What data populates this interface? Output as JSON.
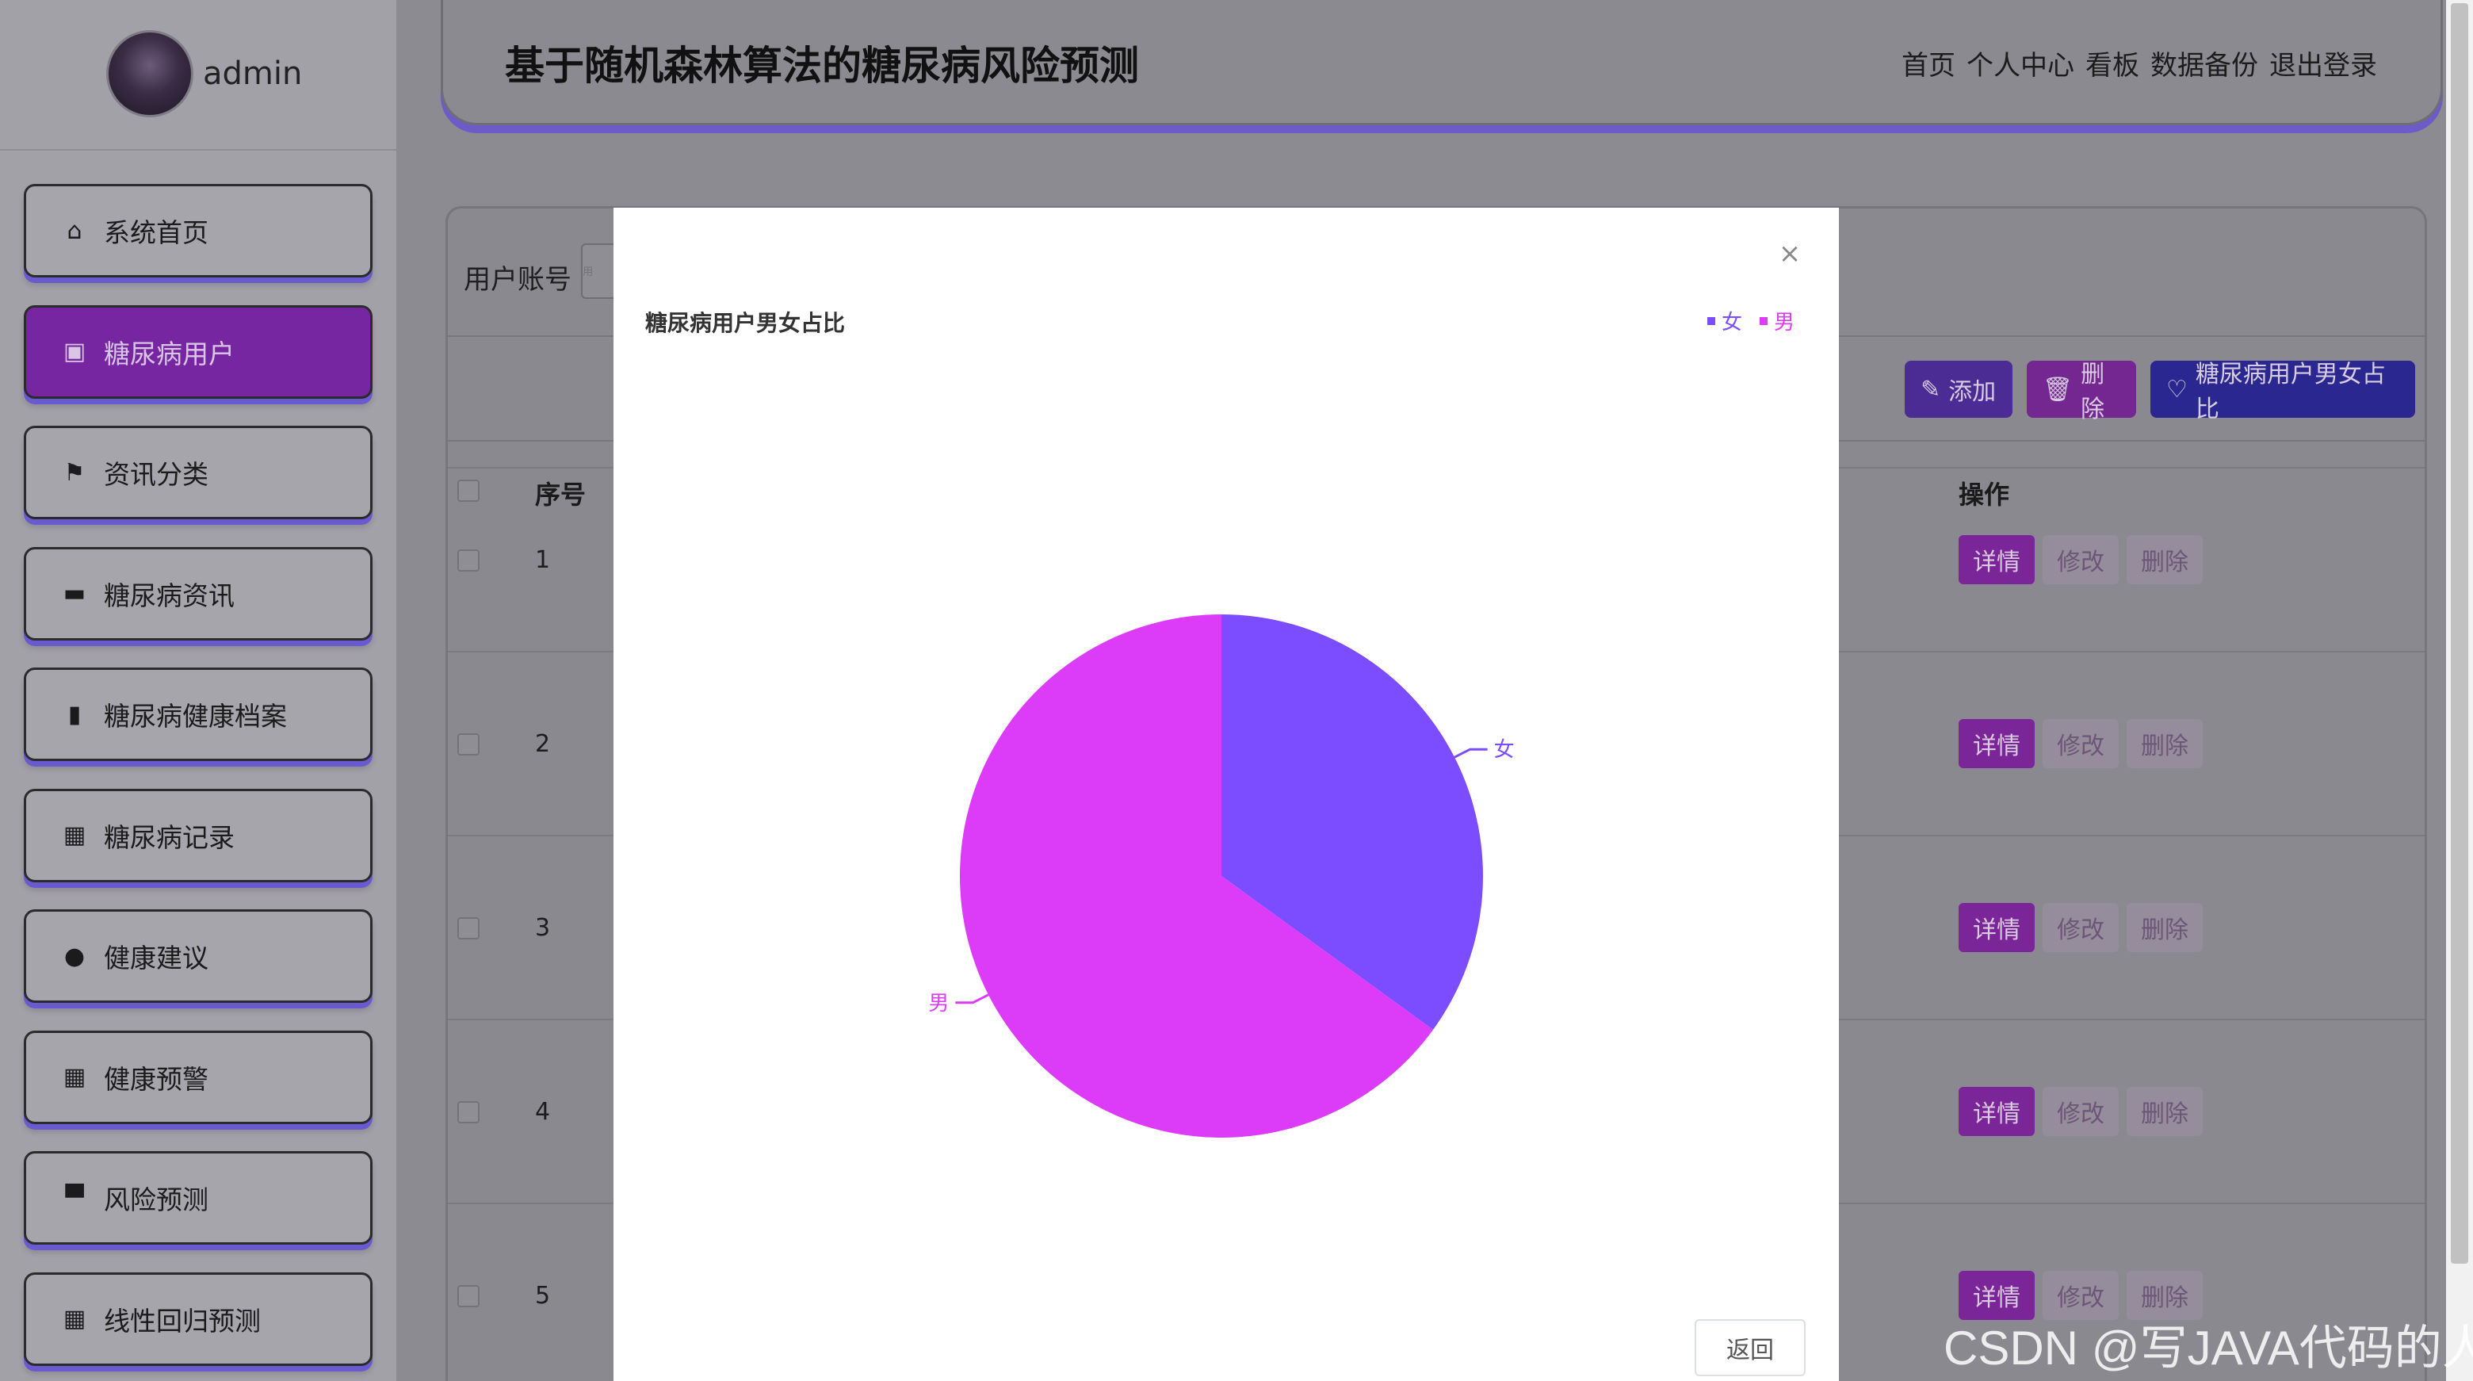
{
  "user": {
    "name": "admin"
  },
  "sidebar": {
    "items": [
      {
        "label": "系统首页",
        "icon": "home-icon",
        "glyph": "⌂",
        "active": false
      },
      {
        "label": "糖尿病用户",
        "icon": "user-badge-icon",
        "glyph": "▣",
        "active": true
      },
      {
        "label": "资讯分类",
        "icon": "flag-icon",
        "glyph": "⚑",
        "active": false
      },
      {
        "label": "糖尿病资讯",
        "icon": "ticket-icon",
        "glyph": "▬",
        "active": false
      },
      {
        "label": "糖尿病健康档案",
        "icon": "bar-chart-icon",
        "glyph": "▮",
        "active": false
      },
      {
        "label": "糖尿病记录",
        "icon": "grid-icon",
        "glyph": "▦",
        "active": false
      },
      {
        "label": "健康建议",
        "icon": "bulb-icon",
        "glyph": "●",
        "active": false
      },
      {
        "label": "健康预警",
        "icon": "grid-icon",
        "glyph": "▦",
        "active": false
      },
      {
        "label": "风险预测",
        "icon": "printer-icon",
        "glyph": "▀",
        "active": false
      },
      {
        "label": "线性回归预测",
        "icon": "grid-icon",
        "glyph": "▦",
        "active": false
      }
    ]
  },
  "header": {
    "title": "基于随机森林算法的糖尿病风险预测",
    "nav": [
      "首页",
      "个人中心",
      "看板",
      "数据备份",
      "退出登录"
    ]
  },
  "search": {
    "label": "用户账号",
    "placeholder": "用"
  },
  "toolbar": {
    "add": "添加",
    "delete": "删除",
    "ratio": "糖尿病用户男女占比"
  },
  "table": {
    "headers": {
      "seq": "序号",
      "op": "操作"
    },
    "rows": [
      "1",
      "2",
      "3",
      "4",
      "5"
    ],
    "ops": {
      "detail": "详情",
      "edit": "修改",
      "delete": "删除"
    }
  },
  "modal": {
    "close": "×",
    "return_label": "返回"
  },
  "chart_data": {
    "type": "pie",
    "title": "糖尿病用户男女占比",
    "legend_position": "top-right",
    "slices": [
      {
        "label": "女",
        "value": 35,
        "color": "#7b4dff"
      },
      {
        "label": "男",
        "value": 65,
        "color": "#dc3cf8"
      }
    ]
  },
  "watermark": "CSDN @写JAVA代码的人"
}
